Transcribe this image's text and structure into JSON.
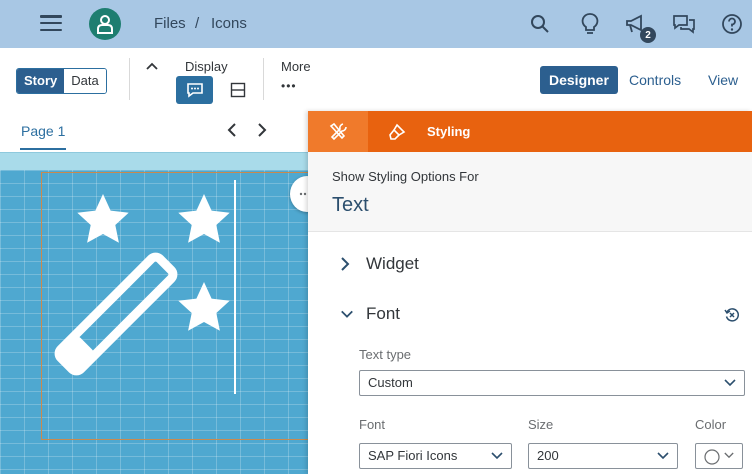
{
  "shell": {
    "breadcrumb": [
      "Files",
      "Icons"
    ],
    "breadcrumb_sep": "/",
    "notification_count": "2"
  },
  "toolbar": {
    "view_toggle": {
      "active": "Story",
      "inactive": "Data"
    },
    "display_label": "Display",
    "more_label": "More",
    "more_glyph": "•••",
    "designer_label": "Designer",
    "controls_label": "Controls",
    "view_label": "View"
  },
  "page": {
    "tab_label": "Page 1"
  },
  "panel": {
    "tab_styling_label": "Styling",
    "header_caption": "Show Styling Options For",
    "header_target": "Text",
    "sections": {
      "widget": "Widget",
      "font": "Font"
    },
    "text_type": {
      "label": "Text type",
      "value": "Custom"
    },
    "font": {
      "label": "Font",
      "value": "SAP Fiori Icons"
    },
    "size": {
      "label": "Size",
      "value": "200"
    },
    "color": {
      "label": "Color"
    }
  },
  "colors": {
    "shell_bg": "#a8c7e4",
    "accent_blue": "#2c5f8f",
    "panel_tab_orange": "#e8620f",
    "avatar_green": "#1e7e70",
    "canvas_bg": "#4fa8d0"
  },
  "icons": [
    "menu-icon",
    "user-icon",
    "search-icon",
    "lightbulb-icon",
    "megaphone-icon",
    "chat-icon",
    "help-icon",
    "chevron-up-icon",
    "comment-icon",
    "panel-icon",
    "more-icon",
    "chevron-left-icon",
    "chevron-right-icon",
    "tools-icon",
    "paint-brush-icon",
    "chevron-down-icon",
    "reset-icon",
    "magic-wand-icon"
  ]
}
